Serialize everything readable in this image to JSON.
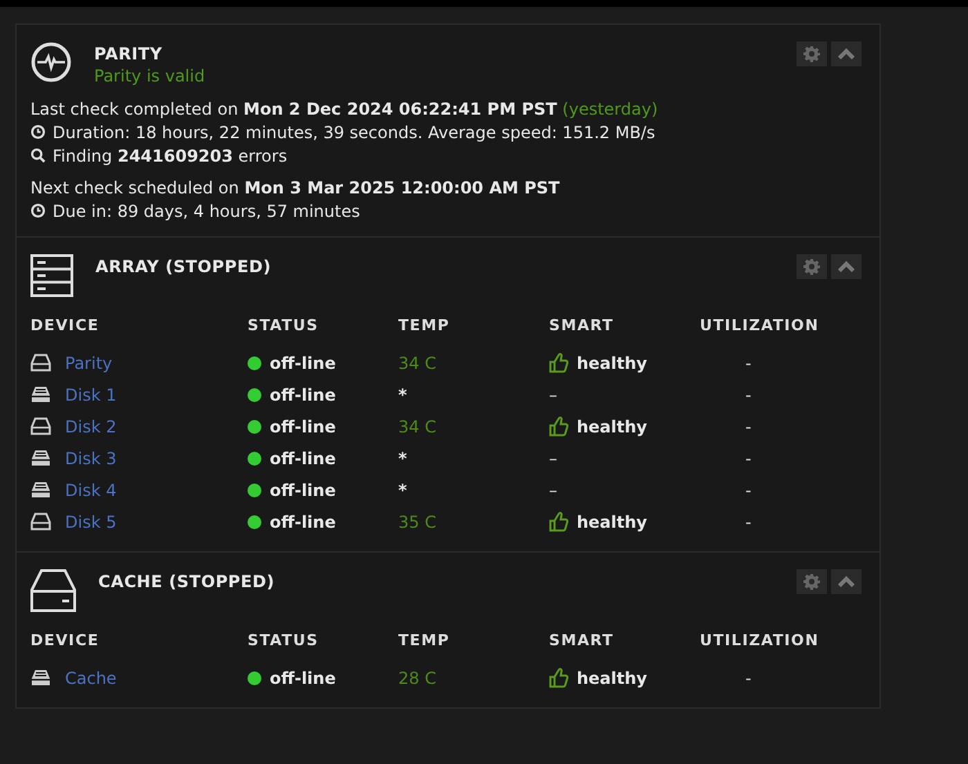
{
  "parity": {
    "title": "PARITY",
    "status": "Parity is valid",
    "last_check": {
      "prefix": "Last check completed on ",
      "date": "Mon 2 Dec 2024 06:22:41 PM PST",
      "relative": "(yesterday)"
    },
    "duration": "Duration: 18 hours, 22 minutes, 39 seconds. Average speed: 151.2 MB/s",
    "finding": "Finding **2441609203** errors",
    "next_check": "Next check scheduled on **Mon 3 Mar 2025 12:00:00 AM PST**",
    "due": "Due in: 89 days, 4 hours, 57 minutes"
  },
  "sections": [
    {
      "title": "ARRAY (STOPPED)",
      "kind": "array",
      "columns": [
        "DEVICE",
        "STATUS",
        "TEMP",
        "SMART",
        "UTILIZATION"
      ],
      "rows": [
        {
          "kind": "hdd",
          "device": "Parity",
          "status": "off-line",
          "temp": "34 C",
          "smart": "healthy",
          "utilization": "-"
        },
        {
          "kind": "ssd",
          "device": "Disk 1",
          "status": "off-line",
          "temp": "*",
          "smart": "–",
          "utilization": "-"
        },
        {
          "kind": "hdd",
          "device": "Disk 2",
          "status": "off-line",
          "temp": "34 C",
          "smart": "healthy",
          "utilization": "-"
        },
        {
          "kind": "ssd",
          "device": "Disk 3",
          "status": "off-line",
          "temp": "*",
          "smart": "–",
          "utilization": "-"
        },
        {
          "kind": "ssd",
          "device": "Disk 4",
          "status": "off-line",
          "temp": "*",
          "smart": "–",
          "utilization": "-"
        },
        {
          "kind": "hdd",
          "device": "Disk 5",
          "status": "off-line",
          "temp": "35 C",
          "smart": "healthy",
          "utilization": "-"
        }
      ]
    },
    {
      "title": "CACHE (STOPPED)",
      "kind": "cache",
      "columns": [
        "DEVICE",
        "STATUS",
        "TEMP",
        "SMART",
        "UTILIZATION"
      ],
      "rows": [
        {
          "kind": "ssd",
          "device": "Cache",
          "status": "off-line",
          "temp": "28 C",
          "smart": "healthy",
          "utilization": "-"
        }
      ]
    }
  ]
}
